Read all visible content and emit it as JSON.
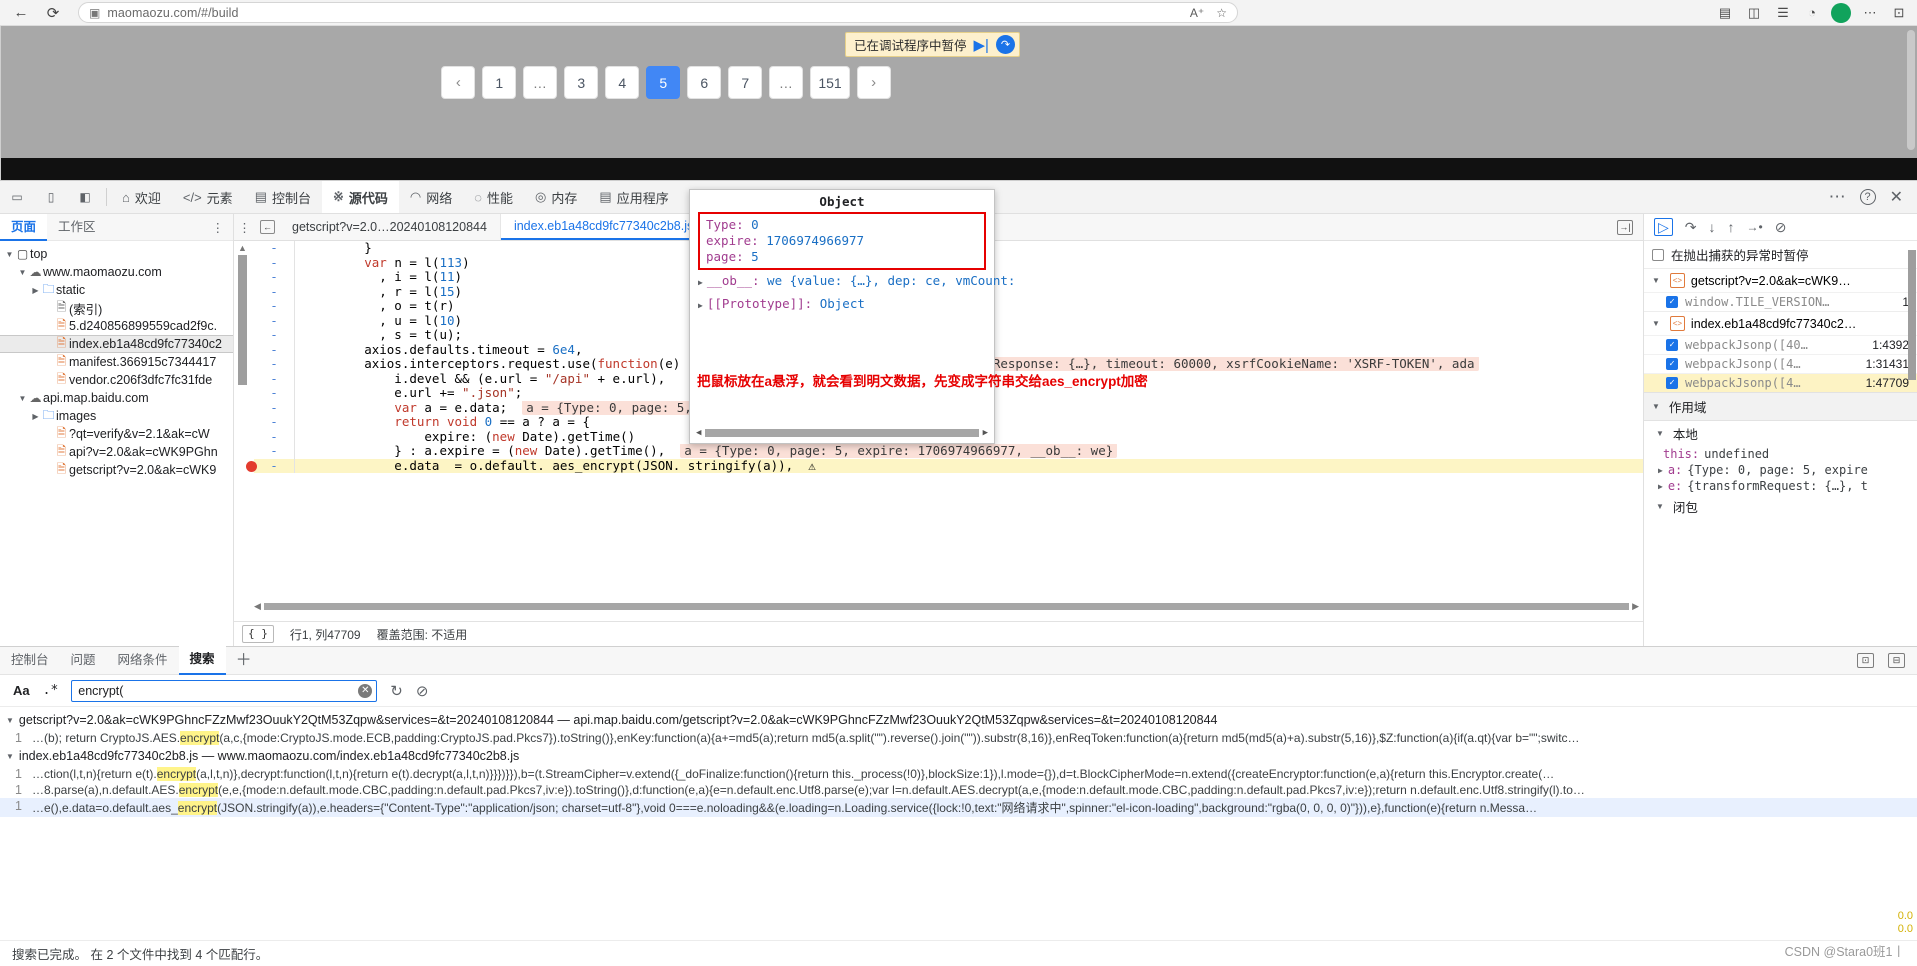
{
  "browser": {
    "back_icon": "←",
    "refresh_icon": "⟳",
    "site_icon": "▣",
    "url": "maomaozu.com/#/build",
    "translate_icon": "A⁺",
    "star_icon": "☆",
    "collections_icon": "▤",
    "split_icon": "◫",
    "menu_icon": "☰",
    "profile_icon": "◔",
    "shield_icon": "◉",
    "more_icon": "⋯",
    "window_icon": "⊡"
  },
  "page": {
    "pagination": [
      "‹",
      "1",
      "…",
      "3",
      "4",
      "5",
      "6",
      "7",
      "…",
      "151",
      "›"
    ],
    "active_page": "5"
  },
  "debug_banner": {
    "text": "已在调试程序中暂停",
    "resume_icon": "▶|",
    "step_icon": "↷"
  },
  "devtools": {
    "inspect_icon": "▭",
    "device_icon": "▯",
    "panel_icon": "◧",
    "tabs": [
      {
        "label": "欢迎",
        "icon": "⌂"
      },
      {
        "label": "元素",
        "icon": "</>"
      },
      {
        "label": "控制台",
        "icon": "▤"
      },
      {
        "label": "源代码",
        "icon": "※"
      },
      {
        "label": "网络",
        "icon": "◠"
      },
      {
        "label": "性能",
        "icon": "◌"
      },
      {
        "label": "内存",
        "icon": "◎"
      },
      {
        "label": "应用程序",
        "icon": "▤"
      }
    ],
    "active_tab": "源代码",
    "more_icon": "⋯",
    "help_icon": "?",
    "close_icon": "✕"
  },
  "navigator": {
    "tabs": [
      "页面",
      "工作区"
    ],
    "active_tab": "页面",
    "kebab_icon": "⋮",
    "tree": [
      {
        "indent": 0,
        "twisty": "▼",
        "icon": "frame",
        "label": "top"
      },
      {
        "indent": 1,
        "twisty": "▼",
        "icon": "cloud",
        "label": "www.maomaozu.com"
      },
      {
        "indent": 2,
        "twisty": "▶",
        "icon": "folder",
        "label": "static"
      },
      {
        "indent": 3,
        "twisty": "",
        "icon": "doc",
        "label": "(索引)"
      },
      {
        "indent": 3,
        "twisty": "",
        "icon": "js",
        "label": "5.d240856899559cad2f9c."
      },
      {
        "indent": 3,
        "twisty": "",
        "icon": "js",
        "label": "index.eb1a48cd9fc77340c2",
        "selected": true
      },
      {
        "indent": 3,
        "twisty": "",
        "icon": "js",
        "label": "manifest.366915c7344417"
      },
      {
        "indent": 3,
        "twisty": "",
        "icon": "js",
        "label": "vendor.c206f3dfc7fc31fde"
      },
      {
        "indent": 1,
        "twisty": "▼",
        "icon": "cloud",
        "label": "api.map.baidu.com"
      },
      {
        "indent": 2,
        "twisty": "▶",
        "icon": "folder",
        "label": "images"
      },
      {
        "indent": 3,
        "twisty": "",
        "icon": "js",
        "label": "?qt=verify&v=2.1&ak=cW"
      },
      {
        "indent": 3,
        "twisty": "",
        "icon": "js",
        "label": "api?v=2.0&ak=cWK9PGhn"
      },
      {
        "indent": 3,
        "twisty": "",
        "icon": "js",
        "label": "getscript?v=2.0&ak=cWK9"
      }
    ]
  },
  "editor": {
    "kebab_icon": "⋮",
    "back_icon": "←",
    "tabs": [
      {
        "label": "getscript?v=2.0…20240108120844",
        "active": false
      },
      {
        "label": "index.eb1a48cd9fc77340c2b8.js",
        "active": true,
        "close": "✕"
      }
    ],
    "dock_icon": "→|",
    "code": [
      {
        "gutter": "-",
        "parts": [
          {
            "t": "        }"
          }
        ]
      },
      {
        "gutter": "-",
        "parts": [
          {
            "t": "        "
          },
          {
            "t": "var",
            "c": "kw"
          },
          {
            "t": " n = l("
          },
          {
            "t": "113",
            "c": "num"
          },
          {
            "t": ")"
          }
        ]
      },
      {
        "gutter": "-",
        "parts": [
          {
            "t": "          , i = l("
          },
          {
            "t": "11",
            "c": "num"
          },
          {
            "t": ")"
          }
        ]
      },
      {
        "gutter": "-",
        "parts": [
          {
            "t": "          , r = l("
          },
          {
            "t": "15",
            "c": "num"
          },
          {
            "t": ")"
          }
        ]
      },
      {
        "gutter": "-",
        "parts": [
          {
            "t": "          , o = t(r)"
          }
        ]
      },
      {
        "gutter": "-",
        "parts": [
          {
            "t": "          , u = l("
          },
          {
            "t": "10",
            "c": "num"
          },
          {
            "t": ")"
          }
        ]
      },
      {
        "gutter": "-",
        "parts": [
          {
            "t": "          , s = t(u);"
          }
        ]
      },
      {
        "gutter": "-",
        "parts": [
          {
            "t": "        axios.defaults.timeout = "
          },
          {
            "t": "6e4",
            "c": "num"
          },
          {
            "t": ","
          }
        ]
      },
      {
        "gutter": "-",
        "parts": [
          {
            "t": "        axios.interceptors.request.use("
          },
          {
            "t": "function",
            "c": "kw"
          },
          {
            "t": "(e) {  "
          },
          {
            "t": "e = {transformRequest: {…}, transformResponse: {…}, timeout: 60000, xsrfCookieName: 'XSRF-TOKEN', ada",
            "c": "inline"
          }
        ]
      },
      {
        "gutter": "-",
        "parts": [
          {
            "t": "            i.devel && (e.url = "
          },
          {
            "t": "\"/api\"",
            "c": "str"
          },
          {
            "t": " + e.url),"
          }
        ]
      },
      {
        "gutter": "-",
        "parts": [
          {
            "t": "            e.url += "
          },
          {
            "t": "\".json\"",
            "c": "str"
          },
          {
            "t": ";"
          }
        ]
      },
      {
        "gutter": "-",
        "parts": [
          {
            "t": "            "
          },
          {
            "t": "var",
            "c": "kw"
          },
          {
            "t": " a = e.data;  "
          },
          {
            "t": "a = {Type: 0, page: 5, expire: 17",
            "c": "inline"
          }
        ]
      },
      {
        "gutter": "-",
        "parts": [
          {
            "t": "            "
          },
          {
            "t": "return",
            "c": "kw"
          },
          {
            "t": " "
          },
          {
            "t": "void",
            "c": "kw"
          },
          {
            "t": " "
          },
          {
            "t": "0",
            "c": "num"
          },
          {
            "t": " == a ? a = {"
          }
        ]
      },
      {
        "gutter": "-",
        "parts": [
          {
            "t": "                expire: ("
          },
          {
            "t": "new",
            "c": "kw"
          },
          {
            "t": " Date).getTime()"
          }
        ]
      },
      {
        "gutter": "-",
        "parts": [
          {
            "t": "            } : a.expire = ("
          },
          {
            "t": "new",
            "c": "kw"
          },
          {
            "t": " Date).getTime(),  "
          },
          {
            "t": "a = {Type: 0, page: 5, expire: 1706974966977, __ob__: we}",
            "c": "inline"
          }
        ]
      },
      {
        "gutter": "-",
        "highlight": true,
        "breakpoint": true,
        "parts": [
          {
            "t": "            e.data  = o.default. aes_encrypt(JSON. stringify(a)),  ⚠"
          }
        ]
      }
    ],
    "status": {
      "pretty_icon": "{ }",
      "position": "行1, 列47709",
      "coverage": "覆盖范围: 不适用"
    }
  },
  "popover": {
    "title": "Object",
    "rows": [
      {
        "key": "Type",
        "val": "0"
      },
      {
        "key": "expire",
        "val": "1706974966977"
      },
      {
        "key": "page",
        "val": "5"
      }
    ],
    "proto_rows": [
      {
        "tri": "▶",
        "name": "__ob__",
        "value": "we {value: {…}, dep: ce, vmCount:"
      },
      {
        "tri": "▶",
        "name": "[[Prototype]]",
        "value": "Object"
      }
    ],
    "note": "把鼠标放在a悬浮，就会看到明文数据，先变成字符串交给aes_encrypt加密"
  },
  "debugger": {
    "toolbar": {
      "resume_icon": "▷",
      "step_over_icon": "↷",
      "step_into_icon": "↓",
      "step_out_icon": "↑",
      "step_icon": "→•",
      "deactivate_icon": "⊘"
    },
    "pause_on_caught": {
      "label": "在抛出捕获的异常时暂停",
      "checked": false
    },
    "breakpoint_groups": [
      {
        "file": "getscript?v=2.0&ak=cWK9…",
        "items": [
          {
            "label": "window.TILE_VERSION…",
            "loc": "1",
            "checked": true,
            "selected": false
          }
        ]
      },
      {
        "file": "index.eb1a48cd9fc77340c2…",
        "items": [
          {
            "label": "webpackJsonp([40…",
            "loc": "1:4392",
            "checked": true,
            "selected": false
          },
          {
            "label": "webpackJsonp([4…",
            "loc": "1:31431",
            "checked": true,
            "selected": false
          },
          {
            "label": "webpackJsonp([4…",
            "loc": "1:47709",
            "checked": true,
            "selected": true
          }
        ]
      }
    ],
    "scope_title": "作用域",
    "scope_local": "本地",
    "scope_rows": [
      {
        "tri": "",
        "name": "this:",
        "value": "undefined"
      },
      {
        "tri": "▶",
        "name": "a:",
        "value": "{Type: 0, page: 5, expire"
      },
      {
        "tri": "▶",
        "name": "e:",
        "value": "{transformRequest: {…}, t"
      }
    ],
    "scope_closure": "闭包"
  },
  "drawer": {
    "tabs": [
      "控制台",
      "问题",
      "网络条件",
      "搜索"
    ],
    "active_tab": "搜索",
    "plus_icon": "＋",
    "dock_icon": "⊡",
    "panel_icon": "⊟",
    "match_case_icon": "Aa",
    "regex_icon": ".*",
    "search_value": "encrypt(",
    "search_placeholder": "",
    "clear_icon": "✕",
    "refresh_icon": "↻",
    "clear_all_icon": "⊘",
    "results": [
      {
        "type": "file",
        "tri": "▼",
        "label": "getscript?v=2.0&ak=cWK9PGhncFZzMwf23OuukY2QtM53Zqpw&services=&t=20240108120844 — api.map.baidu.com/getscript?v=2.0&ak=cWK9PGhncFZzMwf23OuukY2QtM53Zqpw&services=&t=20240108120844"
      },
      {
        "type": "line",
        "num": "1",
        "pre": "…(b); return CryptoJS.AES.",
        "match": "encrypt",
        "post": "(a,c,{mode:CryptoJS.mode.ECB,padding:CryptoJS.pad.Pkcs7}).toString()},enKey:function(a){a+=md5(a);return md5(a.split(\"\").reverse().join(\"\")).substr(8,16)},enReqToken:function(a){return md5(md5(a)+a).substr(5,16)},$Z:function(a){if(a.qt){var b=\"\";switc…"
      },
      {
        "type": "file",
        "tri": "▼",
        "label": "index.eb1a48cd9fc77340c2b8.js — www.maomaozu.com/index.eb1a48cd9fc77340c2b8.js"
      },
      {
        "type": "line",
        "num": "1",
        "pre": "…ction(l,t,n){return e(t).",
        "match": "encrypt",
        "post": "(a,l,t,n)},decrypt:function(l,t,n){return e(t).decrypt(a,l,t,n)}}})}}),b=(t.StreamCipher=v.extend({_doFinalize:function(){return this._process(!0)},blockSize:1}),l.mode={}),d=t.BlockCipherMode=n.extend({createEncryptor:function(e,a){return this.Encryptor.create(…"
      },
      {
        "type": "line",
        "num": "1",
        "pre": "…8.parse(a),n.default.AES.",
        "match": "encrypt",
        "post": "(e,e,{mode:n.default.mode.CBC,padding:n.default.pad.Pkcs7,iv:e}).toString()},d:function(e,a){e=n.default.enc.Utf8.parse(e);var l=n.default.AES.decrypt(a,e,{mode:n.default.mode.CBC,padding:n.default.pad.Pkcs7,iv:e});return n.default.enc.Utf8.stringify(l).to…"
      },
      {
        "type": "line",
        "num": "1",
        "selected": true,
        "pre": "…e(),e.data=o.default.aes_",
        "match": "encrypt",
        "post": "(JSON.stringify(a)),e.headers={\"Content-Type\":\"application/json; charset=utf-8\"},void 0===e.noloading&&(e.loading=n.Loading.service({lock:!0,text:\"网络请求中\",spinner:\"el-icon-loading\",background:\"rgba(0, 0, 0, 0)\"})),e},function(e){return n.Messa…"
      }
    ],
    "status": "搜索已完成。 在 2 个文件中找到 4 个匹配行。"
  },
  "watermark": "CSDN @Stara0班1丨",
  "toasts": [
    "0.0",
    "0.0"
  ]
}
